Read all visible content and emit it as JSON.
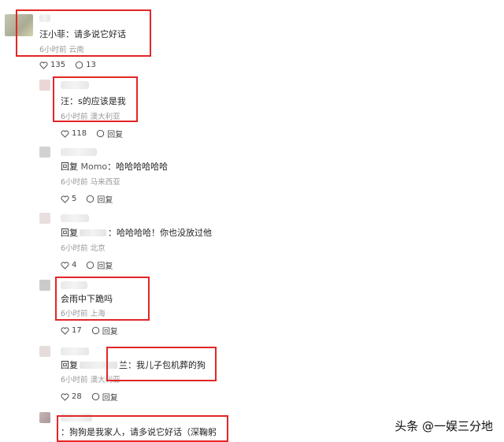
{
  "comments": [
    {
      "text_name": "汪小菲",
      "text_body": "：请多说它好话",
      "meta": "6小时前 云南",
      "likes": "135",
      "replies": "13",
      "avatar_color": "#b7b9a2"
    },
    {
      "text_prefix": "汪：",
      "text_body": "s的应该是我",
      "meta": "6小时前 澳大利亚",
      "likes": "118",
      "reply_label": "回复",
      "avatar_color": "#e8d3d3"
    },
    {
      "reply_word": "回复",
      "reply_target": "Momo",
      "text_body": "：哈哈哈哈哈哈",
      "meta": "6小时前 马来西亚",
      "likes": "5",
      "reply_label": "回复",
      "avatar_color": "#cfcfcf"
    },
    {
      "reply_word": "回复",
      "text_body": "：哈哈哈哈！你也没放过他",
      "meta": "6小时前 北京",
      "likes": "4",
      "reply_label": "回复",
      "avatar_color": "#e7dede"
    },
    {
      "text_body": "会雨中下跪吗",
      "meta": "6小时前 上海",
      "likes": "17",
      "reply_label": "回复",
      "avatar_color": "#c9c9c9"
    },
    {
      "reply_word": "回复",
      "text_body": "兰：我儿子包机葬的狗",
      "meta": "6小时前 澳大利亚",
      "likes": "28",
      "reply_label": "回复",
      "avatar_color": "#e4dada"
    },
    {
      "text_body": "：狗狗是我家人，请多说它好话（深鞠躬",
      "avatar_color": "#b9aaaa"
    }
  ],
  "watermark": "头条 @一娱三分地",
  "colors": {
    "highlight": "#e32626",
    "meta": "#999999"
  }
}
